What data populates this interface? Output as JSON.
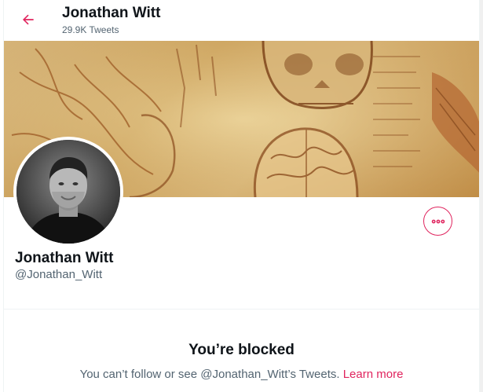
{
  "header": {
    "name": "Jonathan Witt",
    "tweet_count": "29.9K Tweets"
  },
  "profile": {
    "display_name": "Jonathan Witt",
    "handle": "@Jonathan_Witt"
  },
  "blocked": {
    "title": "You’re blocked",
    "message": "You can’t follow or see @Jonathan_Witt’s Tweets.",
    "link_label": "Learn more"
  },
  "icons": {
    "back": "arrow-left-icon",
    "more": "more-horizontal-icon"
  },
  "colors": {
    "accent": "#e0245e",
    "text_primary": "#0f1419",
    "text_secondary": "#536471",
    "banner_base": "#e3c68a"
  }
}
